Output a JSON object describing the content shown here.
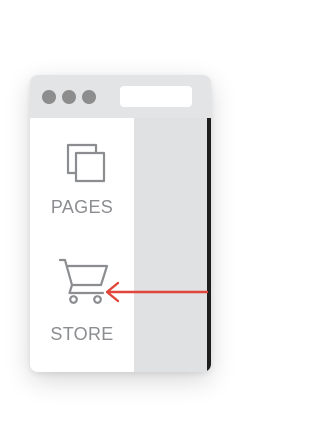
{
  "sidebar": {
    "items": [
      {
        "label": "PAGES",
        "icon": "pages-icon"
      },
      {
        "label": "STORE",
        "icon": "cart-icon"
      }
    ]
  },
  "colors": {
    "titlebar": "#e3e4e5",
    "window_dots": "#8d8d8d",
    "content_area": "#dfe1e2",
    "label_text": "#8b8d90",
    "icon_stroke": "#8b8d90",
    "arrow": "#e0473a"
  }
}
